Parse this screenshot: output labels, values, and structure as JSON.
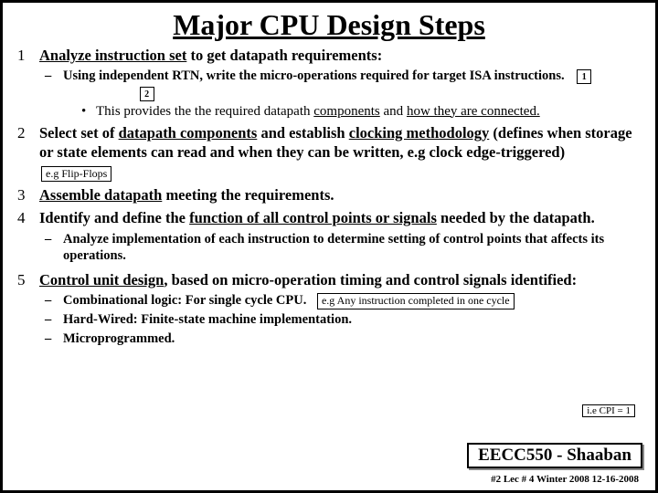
{
  "title": "Major CPU Design Steps",
  "s1": {
    "num": "1",
    "lead": "Analyze instruction set",
    "rest": " to get datapath requirements:",
    "b1a": "Using independent RTN, write the micro-operations required for target ISA instructions.",
    "n1": "1",
    "n2": "2",
    "b1c_a": "This provides the the required datapath ",
    "b1c_b": "components",
    "b1c_c": " and ",
    "b1c_d": "how they are connected.",
    "b1c_d_end": ""
  },
  "s2": {
    "num": "2",
    "a": "Select set of ",
    "b": "datapath components",
    "c": " and establish ",
    "d": "clocking methodology",
    "e": " (defines when storage or state elements can read and when they can be written, e.g clock edge-triggered)",
    "box": "e.g Flip-Flops"
  },
  "s3": {
    "num": "3",
    "a": "Assemble datapath",
    "b": " meeting the requirements."
  },
  "s4": {
    "num": "4",
    "a": "Identify and define the ",
    "b": "function of all control points or signals",
    "c": " needed by the datapath.",
    "sub": "Analyze implementation of each instruction to determine setting of control points that affects its operations."
  },
  "s5": {
    "num": "5",
    "a": "Control unit design",
    "b": ", based on micro-operation timing and control signals identified:",
    "i1": "Combinational logic: For single cycle CPU.",
    "i1box": "e.g Any instruction completed in one cycle",
    "i2": "Hard-Wired:  Finite-state machine implementation.",
    "i3": "Microprogrammed."
  },
  "cpi_box": "i.e CPI = 1",
  "badge": "EECC550 - Shaaban",
  "footer": "#2   Lec # 4   Winter 2008   12-16-2008"
}
